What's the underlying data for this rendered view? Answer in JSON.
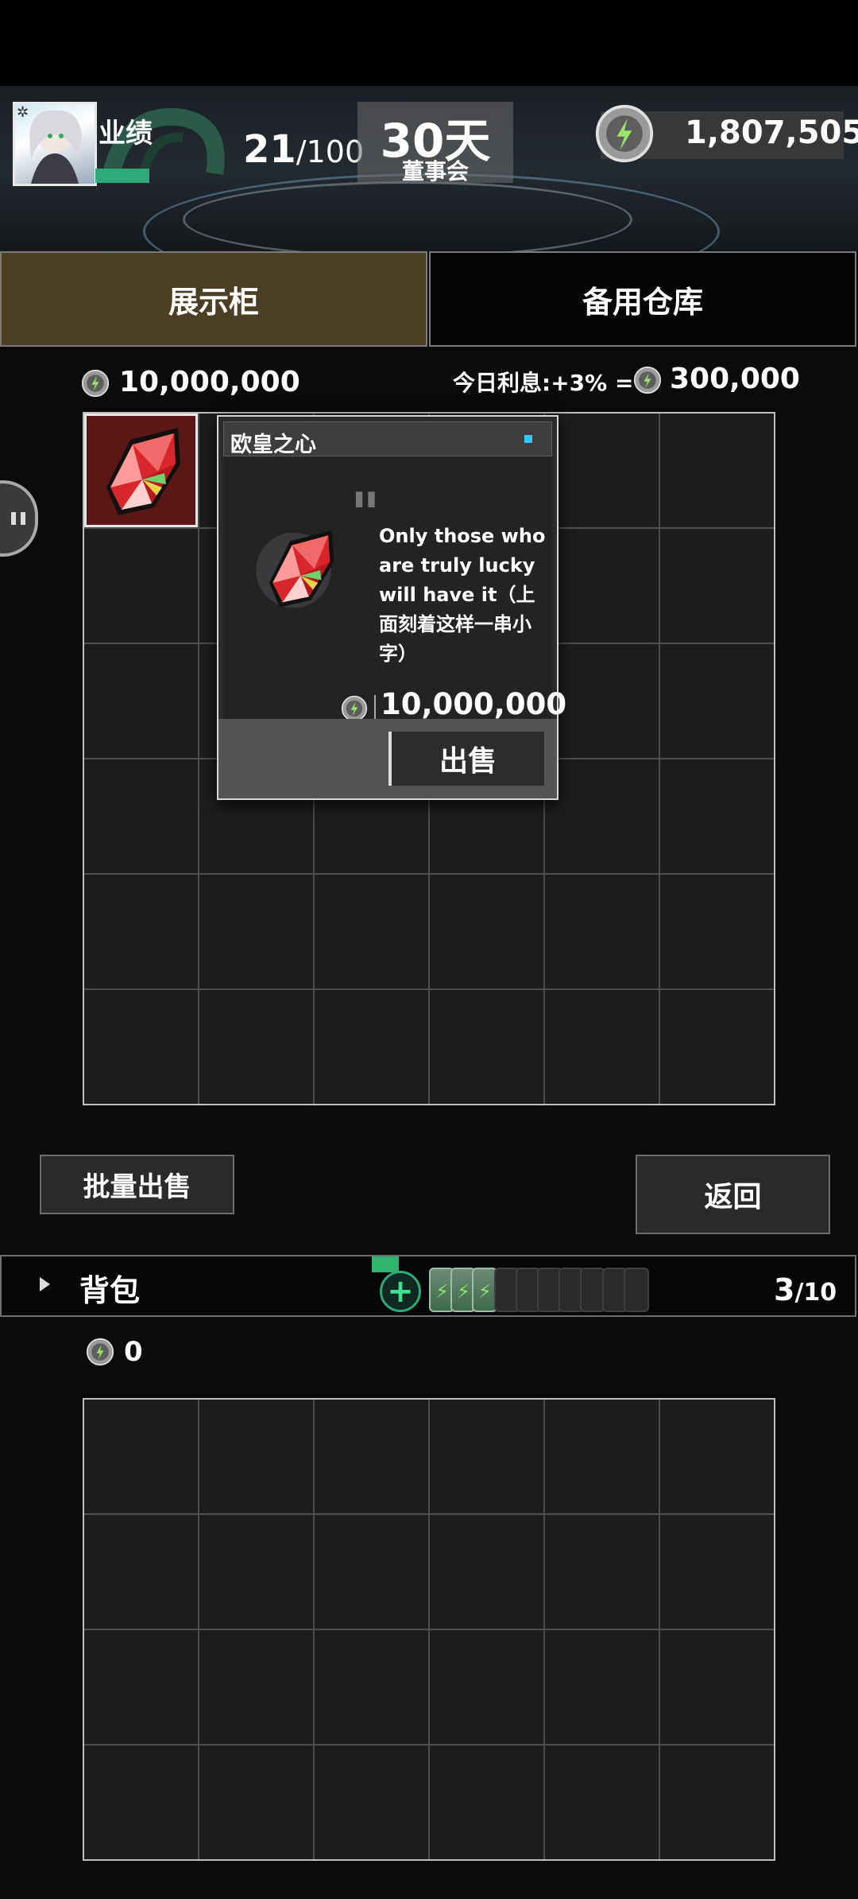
{
  "header": {
    "performance_label": "业绩",
    "performance_current": "21",
    "performance_max": "/100",
    "board_days": "30天",
    "board_label": "董事会",
    "coins": "1,807,505"
  },
  "tabs": {
    "showcase": "展示柜",
    "storage": "备用仓库"
  },
  "showcase": {
    "value": "10,000,000",
    "interest_label": "今日利息:+3% =",
    "interest_value": "300,000"
  },
  "tooltip": {
    "title": "欧皇之心",
    "description": "Only those who are truly lucky will have it（上面刻着这样一串小字）",
    "price": "10,000,000",
    "sell_label": "出售"
  },
  "buttons": {
    "bulk_sell": "批量出售",
    "back": "返回"
  },
  "backpack": {
    "label": "背包",
    "count": "3",
    "max": "/10",
    "value": "0",
    "batteries_filled": 3,
    "batteries_total": 10
  },
  "colors": {
    "tab_active": "#4a3e25",
    "accent_green": "#2fa87a",
    "gem_red": "#d9262c"
  }
}
